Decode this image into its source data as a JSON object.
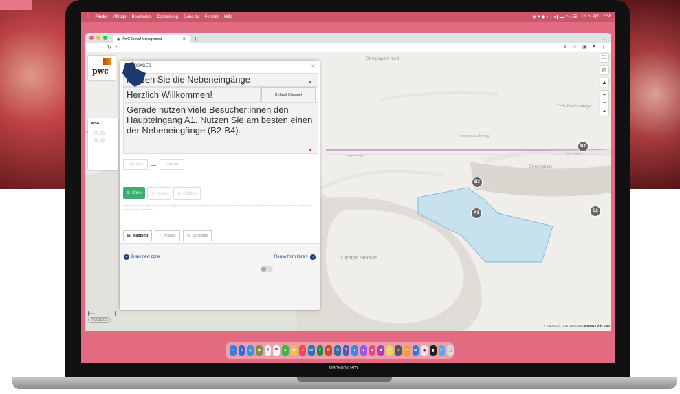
{
  "menubar": {
    "items": [
      "Finder",
      "Ablage",
      "Bearbeiten",
      "Darstellung",
      "Gehe zu",
      "Fenster",
      "Hilfe"
    ],
    "clock": "Di. 5. Apr. 12:58"
  },
  "browser": {
    "tab_title": "PwC Crowd Management",
    "new_tab": "+"
  },
  "map": {
    "labels": {
      "olympic_stadium": "Olympic Stadium",
      "olympiapark_nord": "Olympiapark Nord",
      "zhs": "ZHS-Tennisanlage",
      "olympiahalle": "Olympiahalle",
      "ring_road": "Georg-Brauchle-Ring",
      "lerchenauer": "Lerchenauer",
      "olympiapark": "Olympiapark",
      "sapporobogen": "Sapporobogen"
    },
    "markers": [
      "B4",
      "B3",
      "A1",
      "B2"
    ],
    "attribution_prefix": "© Mapbox © OpenStreetMap",
    "attribution_improve": "Improve this map",
    "mapbox_logo": "mapbox",
    "scale": "30 m"
  },
  "sidebar": {
    "brand": "pwc",
    "msg_label": "MSG"
  },
  "panel": {
    "header": "MESSAGES",
    "title_value": "Nutzen Sie die Nebeneingänge",
    "heading_value": "Herzlich Willkommen!",
    "channel_button": "Default Channel",
    "body_value": "Gerade nutzen viele Besucher:innen den Haupteingang A1. Nutzen Sie am besten einen der Nebeneingänge (B2-B4).",
    "link_text_placeholder": "Link text",
    "link_url_placeholder": "Link url",
    "save": "Save",
    "revert": "revert",
    "publish": "Publish",
    "note": "Deleting this message will cause it to disappear from the control system and stop going out to new app users. It will remain on all the phones to which it has already been dispatched.",
    "tabs": [
      "Mapping",
      "Images",
      "Schedule"
    ],
    "draw_zone": "Draw new zone",
    "reuse_library": "Reuse from library"
  },
  "device": {
    "label": "MacBook Pro"
  },
  "colors": {
    "accent_green": "#3dae6e",
    "link_blue": "#1f3f7a",
    "zone_fill": "#b8dcef",
    "screen_bg": "#e26b82"
  }
}
